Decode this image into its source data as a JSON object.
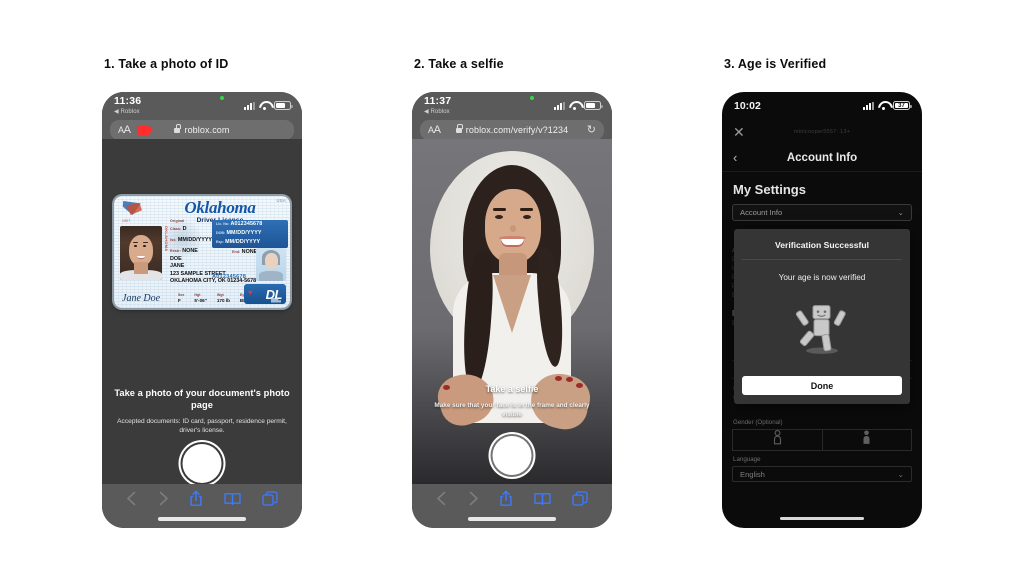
{
  "steps": [
    {
      "caption": "1. Take a photo of ID"
    },
    {
      "caption": "2. Take a selfie"
    },
    {
      "caption": "3. Age is Verified"
    }
  ],
  "phone1": {
    "status": {
      "time": "11:36",
      "back_app": "◀ Roblox"
    },
    "browser": {
      "aa_label": "AA",
      "url": "roblox.com",
      "lock_icon": "lock-icon",
      "recording_icon": "screen-recording-icon"
    },
    "id_card": {
      "state": "Oklahoma",
      "doc_type": "Driver License",
      "usa_mark": "USA",
      "seal_label": "1907",
      "vertical_text": "OKLAHOMA",
      "labels": {
        "original": "Original",
        "class": "Class:",
        "iss": "Iss:",
        "restr": "Restr:",
        "lic_no": "Lic. No:",
        "dob": "DOB:",
        "exp": "Exp:",
        "end": "End:",
        "sex": "Sex",
        "hgt": "Hgt",
        "wgt": "Wgt",
        "eyes": "Eyes"
      },
      "values": {
        "class": "D",
        "iss": "MM/DD/YYYY",
        "restr": "NONE",
        "lic_no": "A012345678",
        "dob": "MM/DD/YYYY",
        "exp": "MM/DD/YYYY",
        "end": "NONE",
        "last_name": "DOE",
        "first_name": "JANE",
        "address_line1": "123 SAMPLE STREET",
        "address_line2": "OKLAHOMA CITY, OK 01234-5678",
        "doc_number": "A012345678",
        "sex": "F",
        "hgt": "5'-06\"",
        "wgt": "170 lb",
        "eyes": "BRO",
        "signature": "Jane Doe",
        "badge": "DL"
      }
    },
    "instructions": {
      "title": "Take a photo of your document's photo page",
      "subtitle": "Accepted documents: ID card, passport, residence permit, driver's license."
    },
    "shutter_label": "shutter-button",
    "toolbar": [
      "back-icon",
      "forward-icon",
      "share-icon",
      "bookmarks-icon",
      "tabs-icon"
    ]
  },
  "phone2": {
    "status": {
      "time": "11:37",
      "back_app": "◀ Roblox"
    },
    "browser": {
      "aa_label": "AA",
      "url": "roblox.com/verify/v?1234",
      "reload_icon": "reload-icon"
    },
    "instructions": {
      "title": "Take a selfie",
      "subtitle": "Make sure that your face is in the frame and clearly visible"
    },
    "shutter_label": "shutter-button",
    "toolbar": [
      "back-icon",
      "forward-icon",
      "share-icon",
      "bookmarks-icon",
      "tabs-icon"
    ]
  },
  "phone3": {
    "status": {
      "time": "10:02",
      "battery": "37"
    },
    "topbar": {
      "close_icon": "close-icon",
      "username": "minicooper5557: 13+"
    },
    "nav": {
      "back_icon": "back-chevron-icon",
      "title": "Account Info"
    },
    "page_title": "My Settings",
    "section_select": {
      "value": "Account Info",
      "chevron": "chevron-down-icon"
    },
    "age_button": "Age Verified",
    "age_note": "By clicking 'Verify My Age,' you will be completing an ID verification process operated by our third party service provider.",
    "gender_label": "Gender (Optional)",
    "gender_options": [
      "female-icon",
      "male-icon"
    ],
    "language_label": "Language",
    "language_value": "English",
    "modal": {
      "title": "Verification Successful",
      "message": "Your age is now verified",
      "mascot_icon": "roblox-character-icon",
      "button": "Done"
    }
  },
  "colors": {
    "accent_blue": "#3c7bff",
    "license_blue": "#1556a8",
    "background": "#ffffff",
    "phone_dark": "#3b3b3b"
  }
}
